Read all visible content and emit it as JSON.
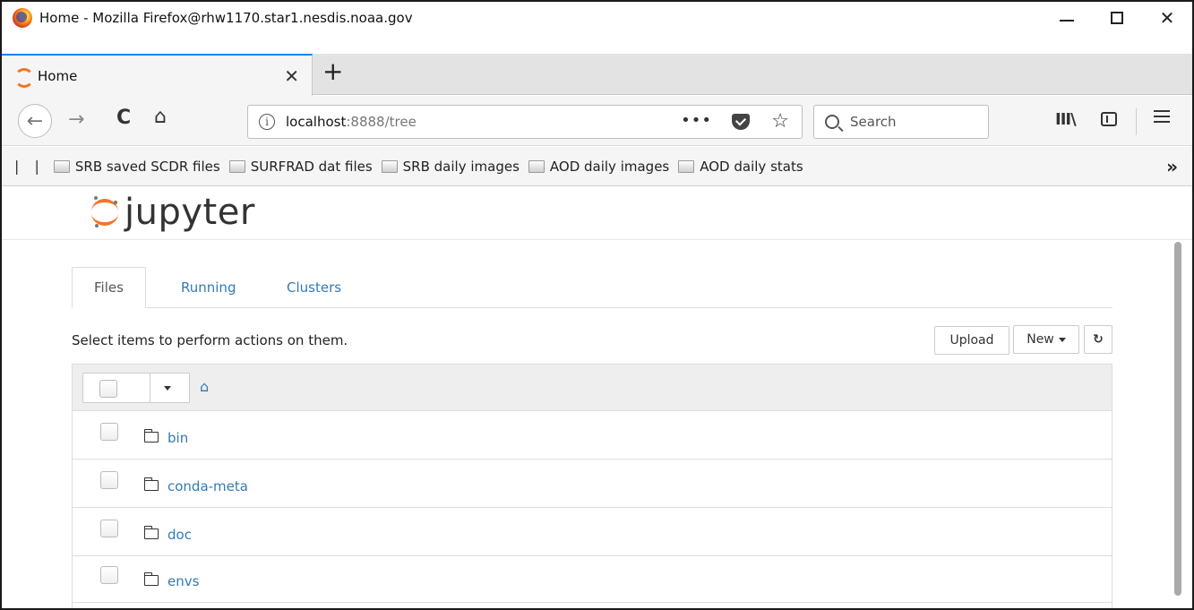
{
  "window": {
    "title": "Home - Mozilla Firefox@rhw1170.star1.nesdis.noaa.gov",
    "minimize": "",
    "maximize": "",
    "close": "✕"
  },
  "tab": {
    "label": "Home",
    "close": "✕",
    "new_tab": "+"
  },
  "navbar": {
    "back": "←",
    "forward": "→",
    "reload": "C",
    "home": "⌂",
    "info": "i",
    "url_host": "localhost",
    "url_rest": ":8888/tree",
    "page_actions": "•••",
    "bookmark_star": "☆",
    "search_placeholder": "Search",
    "library": "III\\"
  },
  "bookmarks": {
    "separator": "| |",
    "items": [
      "SRB saved SCDR files",
      "SURFRAD dat files",
      "SRB daily images",
      "AOD daily images",
      "AOD daily stats"
    ],
    "overflow": "»"
  },
  "jupyter": {
    "logo_text": "jupyter",
    "tabs": [
      "Files",
      "Running",
      "Clusters"
    ],
    "active_tab": "Files",
    "select_hint": "Select items to perform actions on them.",
    "buttons": {
      "upload": "Upload",
      "new": "New",
      "refresh": "↻"
    },
    "home_crumb": "⌂",
    "items": [
      {
        "name": "bin",
        "type": "folder"
      },
      {
        "name": "conda-meta",
        "type": "folder"
      },
      {
        "name": "doc",
        "type": "folder"
      },
      {
        "name": "envs",
        "type": "folder"
      }
    ]
  },
  "colors": {
    "link": "#337ab7",
    "jupyter_orange": "#f37524",
    "firefox_accent": "#0a84ff"
  }
}
